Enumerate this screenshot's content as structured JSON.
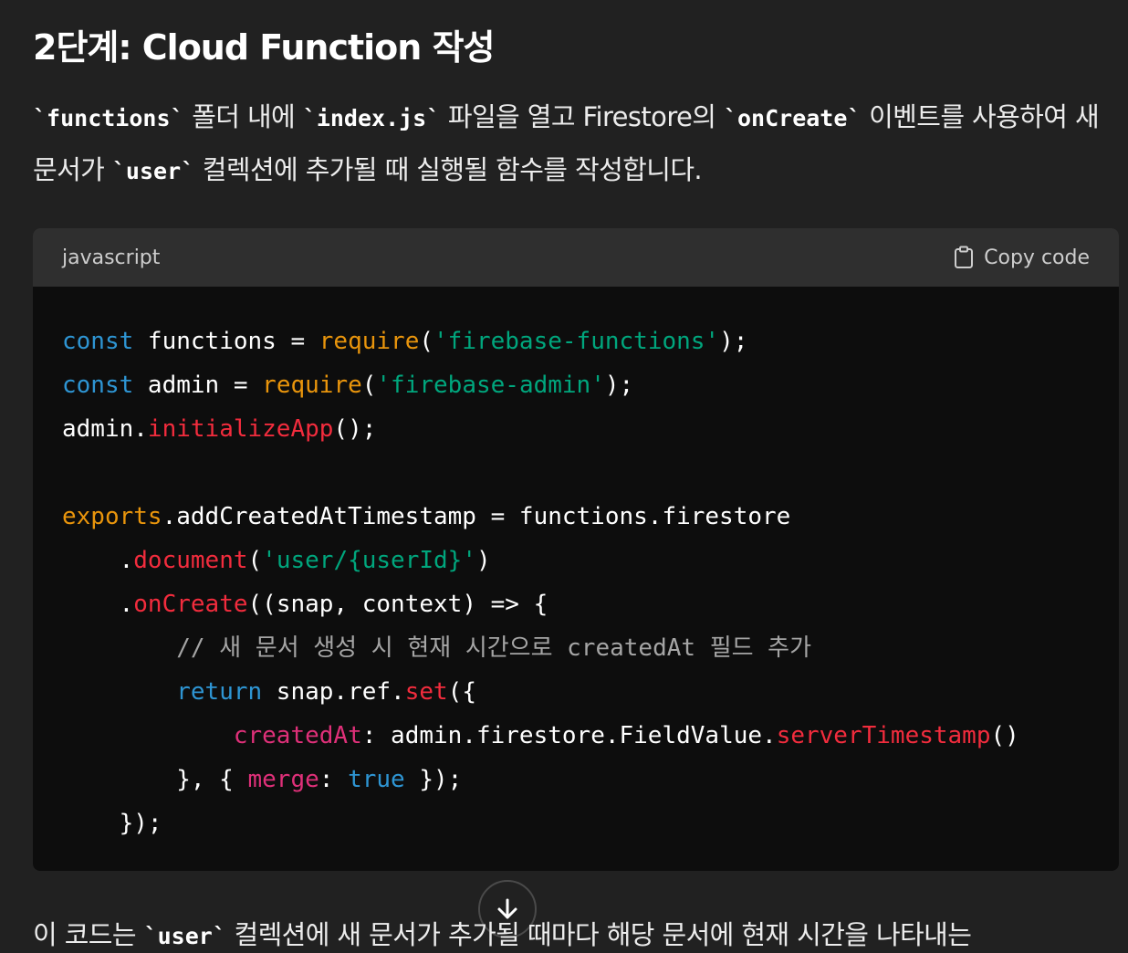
{
  "heading": "2단계: Cloud Function 작성",
  "intro": {
    "code1": "`functions`",
    "text1": " 폴더 내에 ",
    "code2": "`index.js`",
    "text2": " 파일을 열고 Firestore의 ",
    "code3": "`onCreate`",
    "text3": " 이벤트를 사용하여 새 문서가 ",
    "code4": "`user`",
    "text4": " 컬렉션에 추가될 때 실행될 함수를 작성합니다."
  },
  "code_block": {
    "language": "javascript",
    "copy_label": "Copy code",
    "lines": [
      [
        {
          "c": "kw",
          "t": "const"
        },
        {
          "c": "",
          "t": " functions = "
        },
        {
          "c": "fn",
          "t": "require"
        },
        {
          "c": "",
          "t": "("
        },
        {
          "c": "str",
          "t": "'firebase-functions'"
        },
        {
          "c": "",
          "t": ");"
        }
      ],
      [
        {
          "c": "kw",
          "t": "const"
        },
        {
          "c": "",
          "t": " admin = "
        },
        {
          "c": "fn",
          "t": "require"
        },
        {
          "c": "",
          "t": "("
        },
        {
          "c": "str",
          "t": "'firebase-admin'"
        },
        {
          "c": "",
          "t": ");"
        }
      ],
      [
        {
          "c": "",
          "t": "admin."
        },
        {
          "c": "mth",
          "t": "initializeApp"
        },
        {
          "c": "",
          "t": "();"
        }
      ],
      [],
      [
        {
          "c": "fn",
          "t": "exports"
        },
        {
          "c": "",
          "t": ".addCreatedAtTimestamp = functions.firestore"
        }
      ],
      [
        {
          "c": "",
          "t": "    ."
        },
        {
          "c": "mth",
          "t": "document"
        },
        {
          "c": "",
          "t": "("
        },
        {
          "c": "str",
          "t": "'user/{userId}'"
        },
        {
          "c": "",
          "t": ")"
        }
      ],
      [
        {
          "c": "",
          "t": "    ."
        },
        {
          "c": "mth",
          "t": "onCreate"
        },
        {
          "c": "",
          "t": "((snap, context) => {"
        }
      ],
      [
        {
          "c": "",
          "t": "        "
        },
        {
          "c": "cmt",
          "t": "// 새 문서 생성 시 현재 시간으로 createdAt 필드 추가"
        }
      ],
      [
        {
          "c": "",
          "t": "        "
        },
        {
          "c": "kw",
          "t": "return"
        },
        {
          "c": "",
          "t": " snap.ref."
        },
        {
          "c": "mth",
          "t": "set"
        },
        {
          "c": "",
          "t": "({"
        }
      ],
      [
        {
          "c": "",
          "t": "            "
        },
        {
          "c": "prop",
          "t": "createdAt"
        },
        {
          "c": "",
          "t": ": admin.firestore.FieldValue."
        },
        {
          "c": "mth",
          "t": "serverTimestamp"
        },
        {
          "c": "",
          "t": "()"
        }
      ],
      [
        {
          "c": "",
          "t": "        }, { "
        },
        {
          "c": "prop",
          "t": "merge"
        },
        {
          "c": "",
          "t": ": "
        },
        {
          "c": "kw",
          "t": "true"
        },
        {
          "c": "",
          "t": " });"
        }
      ],
      [
        {
          "c": "",
          "t": "    });"
        }
      ]
    ]
  },
  "outro": {
    "text1": "이 코드는 ",
    "code1": "`user`",
    "text2": " 컬렉션에 새 문서가 추가될 때마다 해당 문서에 현재 시간을 나타내는"
  },
  "icons": {
    "copy": "clipboard-icon",
    "scroll": "arrow-down-icon"
  }
}
